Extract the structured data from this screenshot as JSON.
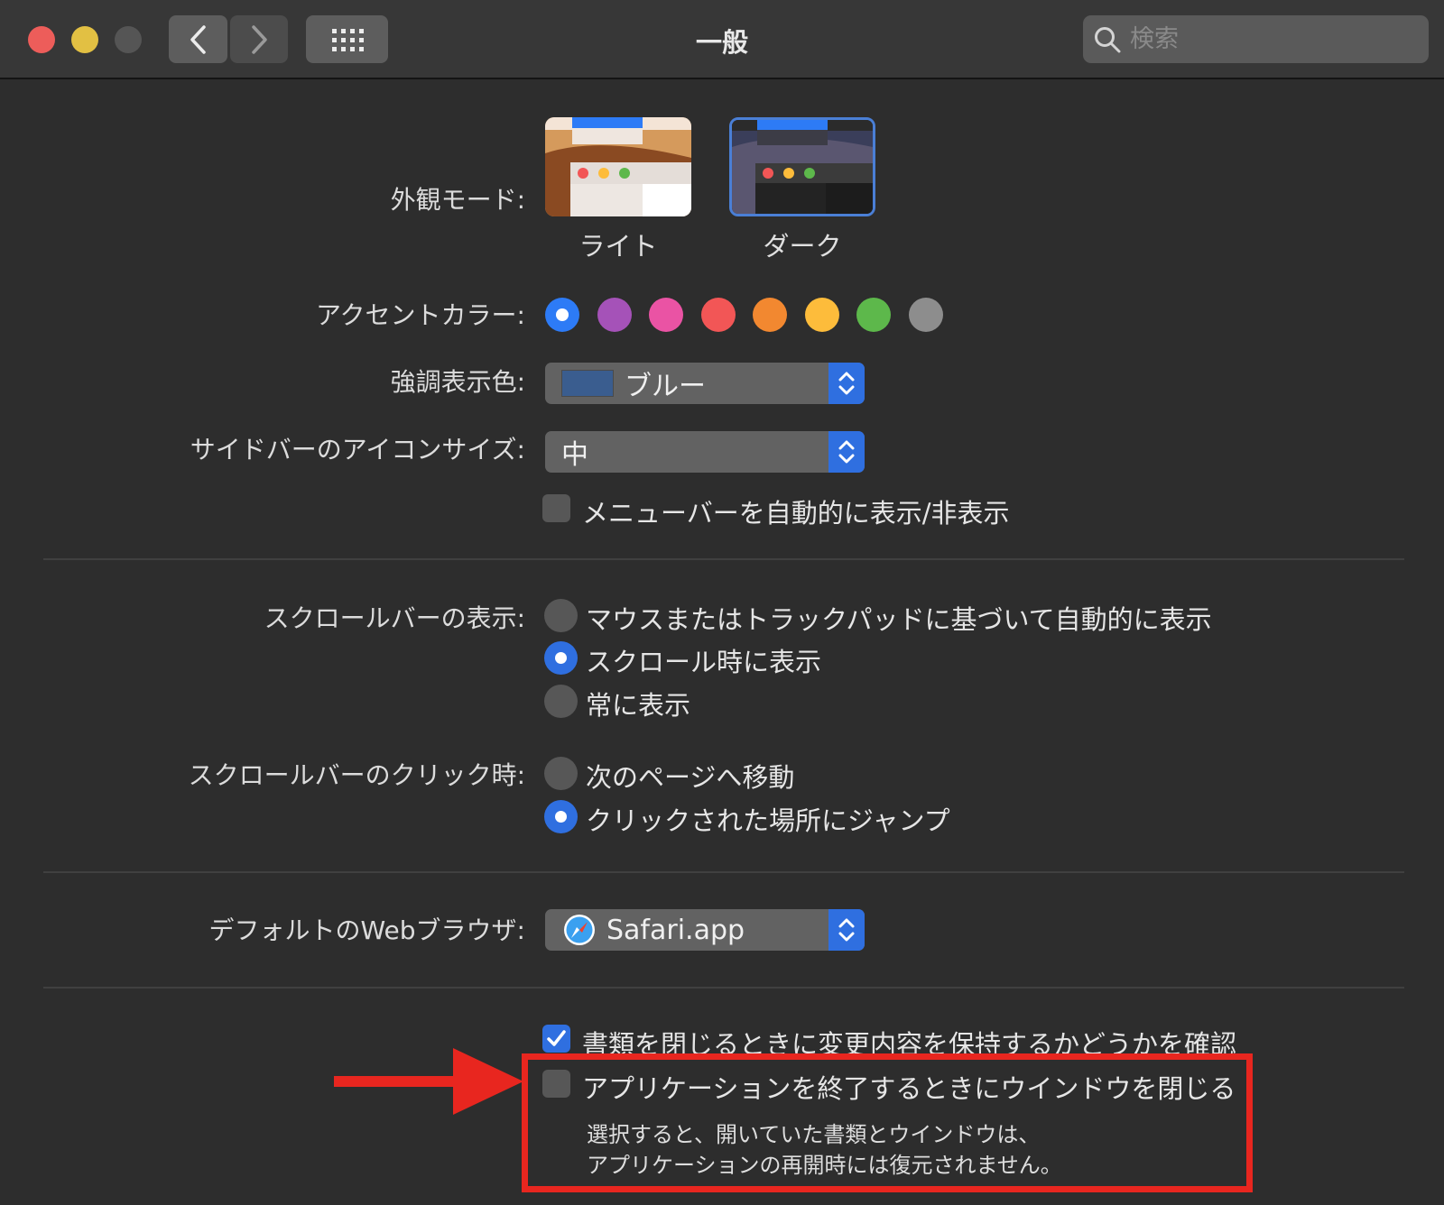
{
  "window": {
    "title": "一般",
    "search": {
      "placeholder": "検索"
    }
  },
  "appearance": {
    "label": "外観モード:",
    "options": [
      {
        "label": "ライト",
        "selected": false
      },
      {
        "label": "ダーク",
        "selected": true
      }
    ]
  },
  "accent": {
    "label": "アクセントカラー:",
    "colors": [
      "#2d7bf6",
      "#a552b8",
      "#ea53a4",
      "#f25656",
      "#f28830",
      "#fdbc3b",
      "#5db84b",
      "#8d8d8d"
    ],
    "selected_index": 0
  },
  "highlight": {
    "label": "強調表示色:",
    "value": "ブルー",
    "swatch_color": "#3a5d8f"
  },
  "sidebar_icon": {
    "label": "サイドバーのアイコンサイズ:",
    "value": "中"
  },
  "menubar_autohide": {
    "label": "メニューバーを自動的に表示/非表示",
    "checked": false
  },
  "scrollbar_show": {
    "label": "スクロールバーの表示:",
    "options": [
      {
        "label": "マウスまたはトラックパッドに基づいて自動的に表示",
        "selected": false
      },
      {
        "label": "スクロール時に表示",
        "selected": true
      },
      {
        "label": "常に表示",
        "selected": false
      }
    ]
  },
  "scrollbar_click": {
    "label": "スクロールバーのクリック時:",
    "options": [
      {
        "label": "次のページへ移動",
        "selected": false
      },
      {
        "label": "クリックされた場所にジャンプ",
        "selected": true
      }
    ]
  },
  "browser": {
    "label": "デフォルトのWebブラウザ:",
    "value": "Safari.app"
  },
  "ask_keep_changes": {
    "label": "書類を閉じるときに変更内容を保持するかどうかを確認",
    "checked": true
  },
  "close_windows": {
    "label": "アプリケーションを終了するときにウインドウを閉じる",
    "checked": false,
    "note_line1": "選択すると、開いていた書類とウインドウは、",
    "note_line2": "アプリケーションの再開時には復元されません。"
  },
  "colors": {
    "window_bg": "#2d2d2d",
    "accent_blue": "#2f6fe0",
    "annotation_red": "#e8261f"
  }
}
